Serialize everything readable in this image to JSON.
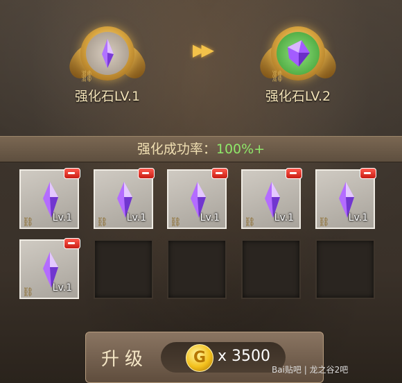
{
  "source_item": {
    "label": "强化石LV.1"
  },
  "target_item": {
    "label": "强化石LV.2"
  },
  "success_rate": {
    "label": "强化成功率：",
    "value": "100%+"
  },
  "slots": [
    {
      "filled": true,
      "level": "Lv.1"
    },
    {
      "filled": true,
      "level": "Lv.1"
    },
    {
      "filled": true,
      "level": "Lv.1"
    },
    {
      "filled": true,
      "level": "Lv.1"
    },
    {
      "filled": true,
      "level": "Lv.1"
    },
    {
      "filled": true,
      "level": "Lv.1"
    },
    {
      "filled": false
    },
    {
      "filled": false
    },
    {
      "filled": false
    },
    {
      "filled": false
    }
  ],
  "upgrade_button": {
    "label": "升级",
    "cost": "x 3500",
    "currency_icon": "gold-coin-icon"
  },
  "watermark": {
    "text": "Bai贴吧 | 龙之谷2吧"
  },
  "colors": {
    "rate_value": "#8fe86a",
    "gem": "#a85cff",
    "coin": "#f3c01c"
  }
}
